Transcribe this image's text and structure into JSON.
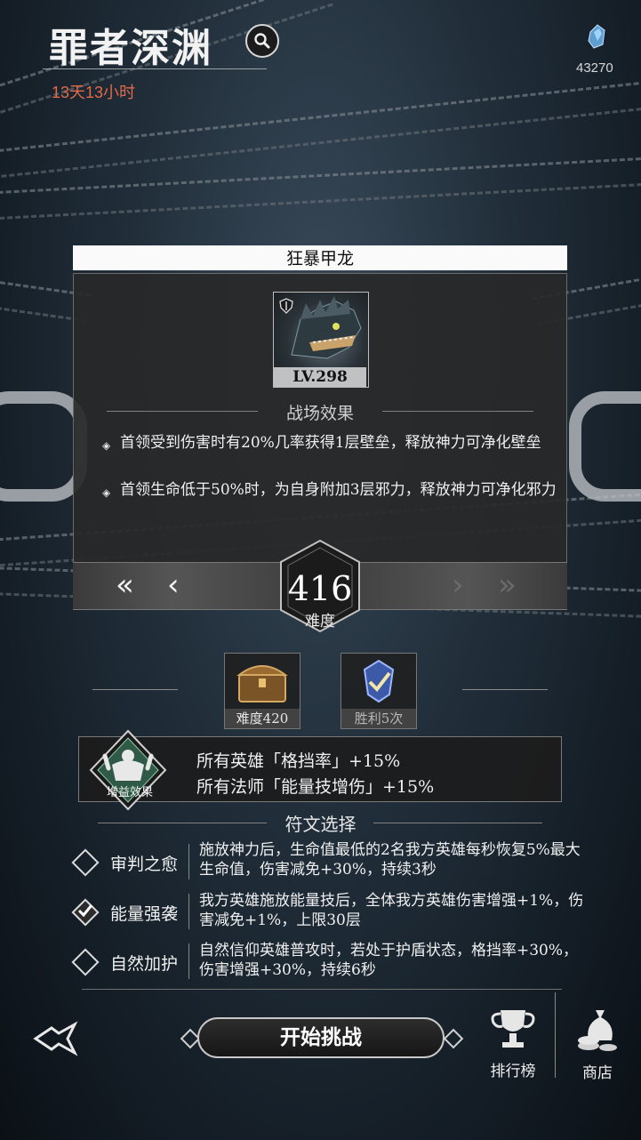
{
  "header": {
    "title": "罪者深渊",
    "timer": "13天13小时",
    "currency_count": "43270"
  },
  "boss": {
    "name": "狂暴甲龙",
    "level": "LV.298",
    "effects_title": "战场效果",
    "effects": [
      "首领受到伤害时有20%几率获得1层壁垒，释放神力可净化壁垒",
      "首领生命低于50%时，为自身附加3层邪力，释放神力可净化邪力"
    ]
  },
  "difficulty": {
    "value": "416",
    "label": "难度"
  },
  "rewards": [
    {
      "label": "难度420",
      "icon": "treasure-chest-icon"
    },
    {
      "label": "胜利5次",
      "icon": "victory-badge-icon"
    }
  ],
  "buff": {
    "label": "增益效果",
    "lines": [
      "所有英雄「格挡率」+15%",
      "所有法师「能量技增伤」+15%"
    ]
  },
  "runes": {
    "title": "符文选择",
    "items": [
      {
        "name": "审判之愈",
        "desc": "施放神力后，生命值最低的2名我方英雄每秒恢复5%最大生命值，伤害减免+30%，持续3秒",
        "selected": false
      },
      {
        "name": "能量强袭",
        "desc": "我方英雄施放能量技后，全体我方英雄伤害增强+1%，伤害减免+1%，上限30层",
        "selected": true
      },
      {
        "name": "自然加护",
        "desc": "自然信仰英雄普攻时，若处于护盾状态，格挡率+30%，伤害增强+30%，持续6秒",
        "selected": false
      }
    ]
  },
  "bottom": {
    "start_label": "开始挑战",
    "ranking_label": "排行榜",
    "shop_label": "商店"
  },
  "colors": {
    "timer": "#e06a4a",
    "panel_bg": "#282828",
    "accent_white": "#fafafa"
  }
}
